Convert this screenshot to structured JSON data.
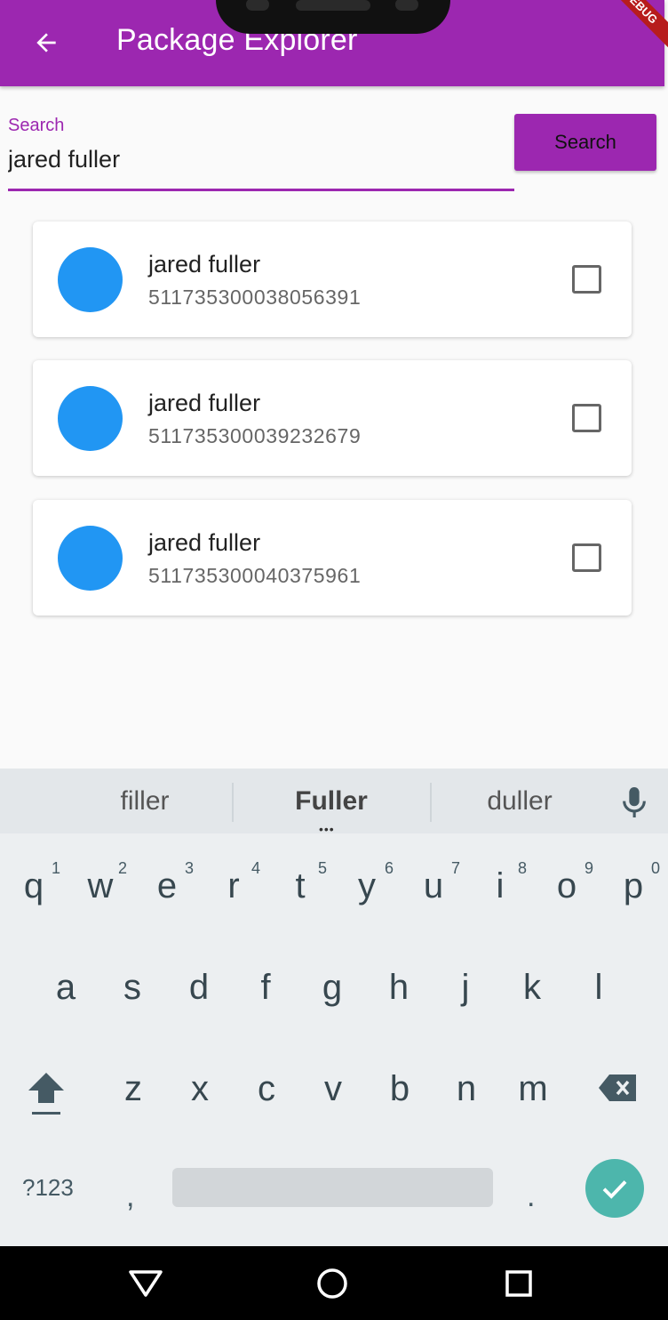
{
  "app_bar": {
    "title": "Package Explorer",
    "debug_banner": "DEBUG",
    "color": "#9c27b0"
  },
  "search": {
    "label": "Search",
    "value": "jared fuller",
    "button_label": "Search"
  },
  "packages": [
    {
      "name": "jared fuller",
      "id": "511735300038056391",
      "checked": false
    },
    {
      "name": "jared fuller",
      "id": "511735300039232679",
      "checked": false
    },
    {
      "name": "jared fuller",
      "id": "511735300040375961",
      "checked": false
    }
  ],
  "keyboard": {
    "suggestions": [
      "filler",
      "Fuller",
      "duller"
    ],
    "row1": [
      "q",
      "w",
      "e",
      "r",
      "t",
      "y",
      "u",
      "i",
      "o",
      "p"
    ],
    "row1_numbers": [
      "1",
      "2",
      "3",
      "4",
      "5",
      "6",
      "7",
      "8",
      "9",
      "0"
    ],
    "row2": [
      "a",
      "s",
      "d",
      "f",
      "g",
      "h",
      "j",
      "k",
      "l"
    ],
    "row3": [
      "z",
      "x",
      "c",
      "v",
      "b",
      "n",
      "m"
    ],
    "symbols_label": "?123",
    "comma": ",",
    "period": ".",
    "enter_color": "#4db6ac"
  },
  "icons": {
    "back": "arrow-back-icon",
    "mic": "microphone-icon",
    "shift": "shift-icon",
    "backspace": "backspace-icon",
    "enter": "check-icon",
    "nav_back": "triangle-back-icon",
    "nav_home": "circle-home-icon",
    "nav_recents": "square-recents-icon"
  }
}
